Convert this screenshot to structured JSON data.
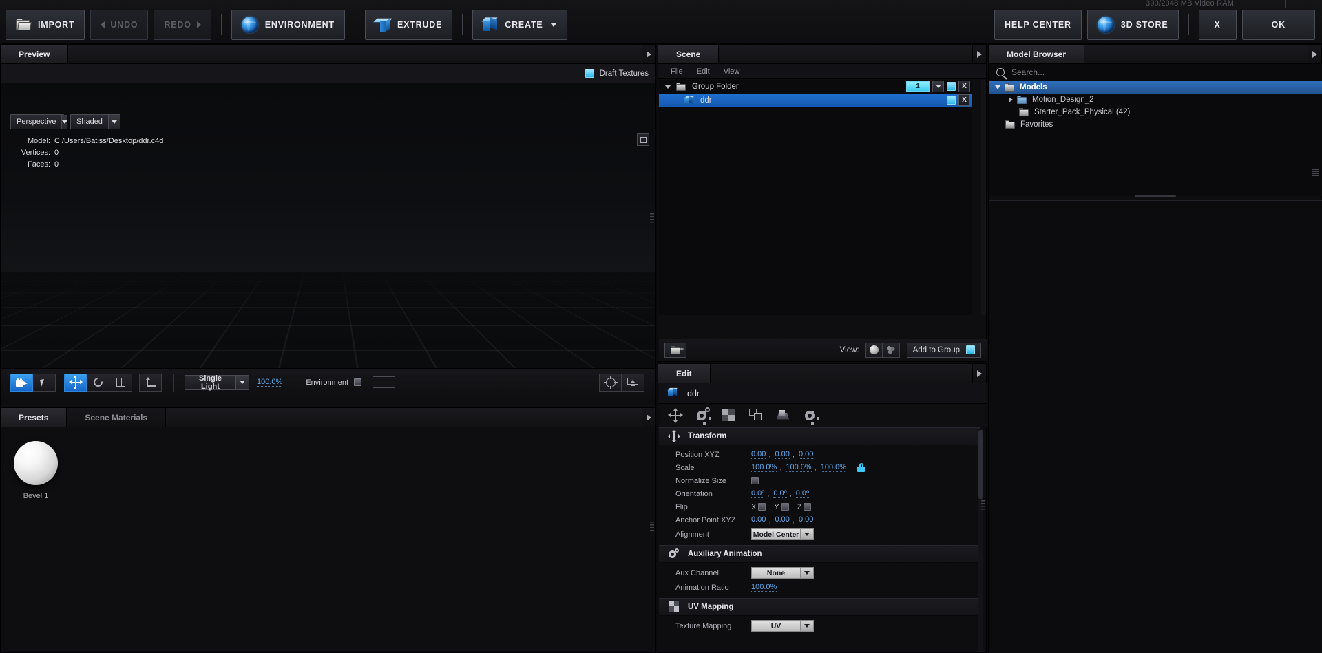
{
  "toolbar": {
    "vram": "390/2048 MB Video RAM",
    "import": "IMPORT",
    "undo": "UNDO",
    "redo": "REDO",
    "environment": "ENVIRONMENT",
    "extrude": "EXTRUDE",
    "create": "CREATE",
    "help_center": "HELP CENTER",
    "store": "3D STORE",
    "close": "X",
    "ok": "OK"
  },
  "preview": {
    "tab": "Preview",
    "draft_textures": "Draft Textures",
    "camera_mode": "Perspective",
    "shading_mode": "Shaded",
    "model_label": "Model:",
    "model_path": "C:/Users/Batiss/Desktop/ddr.c4d",
    "vertices_label": "Vertices:",
    "vertices_value": "0",
    "faces_label": "Faces:",
    "faces_value": "0",
    "light_preset": "Single Light",
    "light_intensity": "100.0%",
    "environment_label": "Environment",
    "environment_color": "#141418"
  },
  "presets": {
    "tab_presets": "Presets",
    "tab_scene_materials": "Scene Materials",
    "materials": [
      {
        "name": "Bevel 1"
      }
    ]
  },
  "scene": {
    "tab": "Scene",
    "menus": [
      "File",
      "Edit",
      "View"
    ],
    "rows": [
      {
        "name": "Group Folder",
        "type": "folder",
        "count": "1",
        "selected": false,
        "close": "X"
      },
      {
        "name": "ddr",
        "type": "model",
        "selected": true,
        "close": "X"
      }
    ],
    "footer": {
      "view_label": "View:",
      "add_to_group": "Add to Group"
    }
  },
  "edit": {
    "tab": "Edit",
    "object_name": "ddr",
    "sections": [
      {
        "title": "Transform",
        "icon": "move-icon",
        "rows": [
          {
            "label": "Position XYZ",
            "kind": "triple",
            "values": [
              "0.00",
              "0.00",
              "0.00"
            ]
          },
          {
            "label": "Scale",
            "kind": "triple-lock",
            "values": [
              "100.0%",
              "100.0%",
              "100.0%"
            ]
          },
          {
            "label": "Normalize Size",
            "kind": "checkbox",
            "checked": false
          },
          {
            "label": "Orientation",
            "kind": "triple",
            "values": [
              "0.0º",
              "0.0º",
              "0.0º"
            ]
          },
          {
            "label": "Flip",
            "kind": "axis-checks",
            "axes": [
              "X",
              "Y",
              "Z"
            ]
          },
          {
            "label": "Anchor Point XYZ",
            "kind": "triple",
            "values": [
              "0.00",
              "0.00",
              "0.00"
            ]
          },
          {
            "label": "Alignment",
            "kind": "dropdown",
            "value": "Model Center"
          }
        ]
      },
      {
        "title": "Auxiliary Animation",
        "icon": "gears-icon",
        "rows": [
          {
            "label": "Aux Channel",
            "kind": "dropdown",
            "value": "None"
          },
          {
            "label": "Animation Ratio",
            "kind": "single",
            "values": [
              "100.0%"
            ]
          }
        ]
      },
      {
        "title": "UV Mapping",
        "icon": "checker-icon",
        "rows": [
          {
            "label": "Texture Mapping",
            "kind": "dropdown",
            "value": "UV"
          }
        ]
      }
    ]
  },
  "browser": {
    "tab": "Model Browser",
    "search_placeholder": "Search...",
    "tree": [
      {
        "label": "Models",
        "depth": 0,
        "expanded": true,
        "selected": true,
        "folder": "white"
      },
      {
        "label": "Motion_Design_2",
        "depth": 1,
        "expanded": false,
        "selected": false,
        "folder": "blue"
      },
      {
        "label": "Starter_Pack_Physical (42)",
        "depth": 1,
        "selected": false,
        "folder": "white"
      },
      {
        "label": "Favorites",
        "depth": 0,
        "selected": false,
        "folder": "white"
      }
    ]
  },
  "colors": {
    "accent_cyan": "#3ecdf2",
    "accent_blue": "#1f6fd0",
    "link_blue": "#5fa9e8",
    "panel_bg": "#0e0e11"
  }
}
